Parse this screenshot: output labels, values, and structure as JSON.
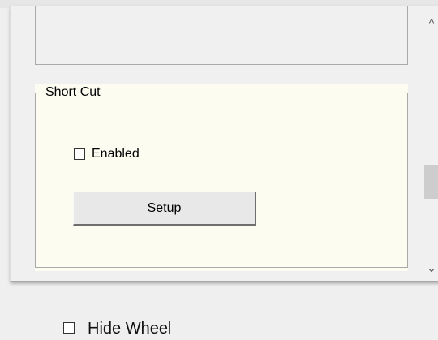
{
  "shortcut": {
    "legend": "Short Cut",
    "enabled_label": "Enabled",
    "enabled_checked": false,
    "setup_label": "Setup"
  },
  "scrollbar": {
    "up_glyph": "^",
    "down_glyph": "⌄"
  },
  "hide_wheel": {
    "label": "Hide Wheel",
    "checked": false
  }
}
